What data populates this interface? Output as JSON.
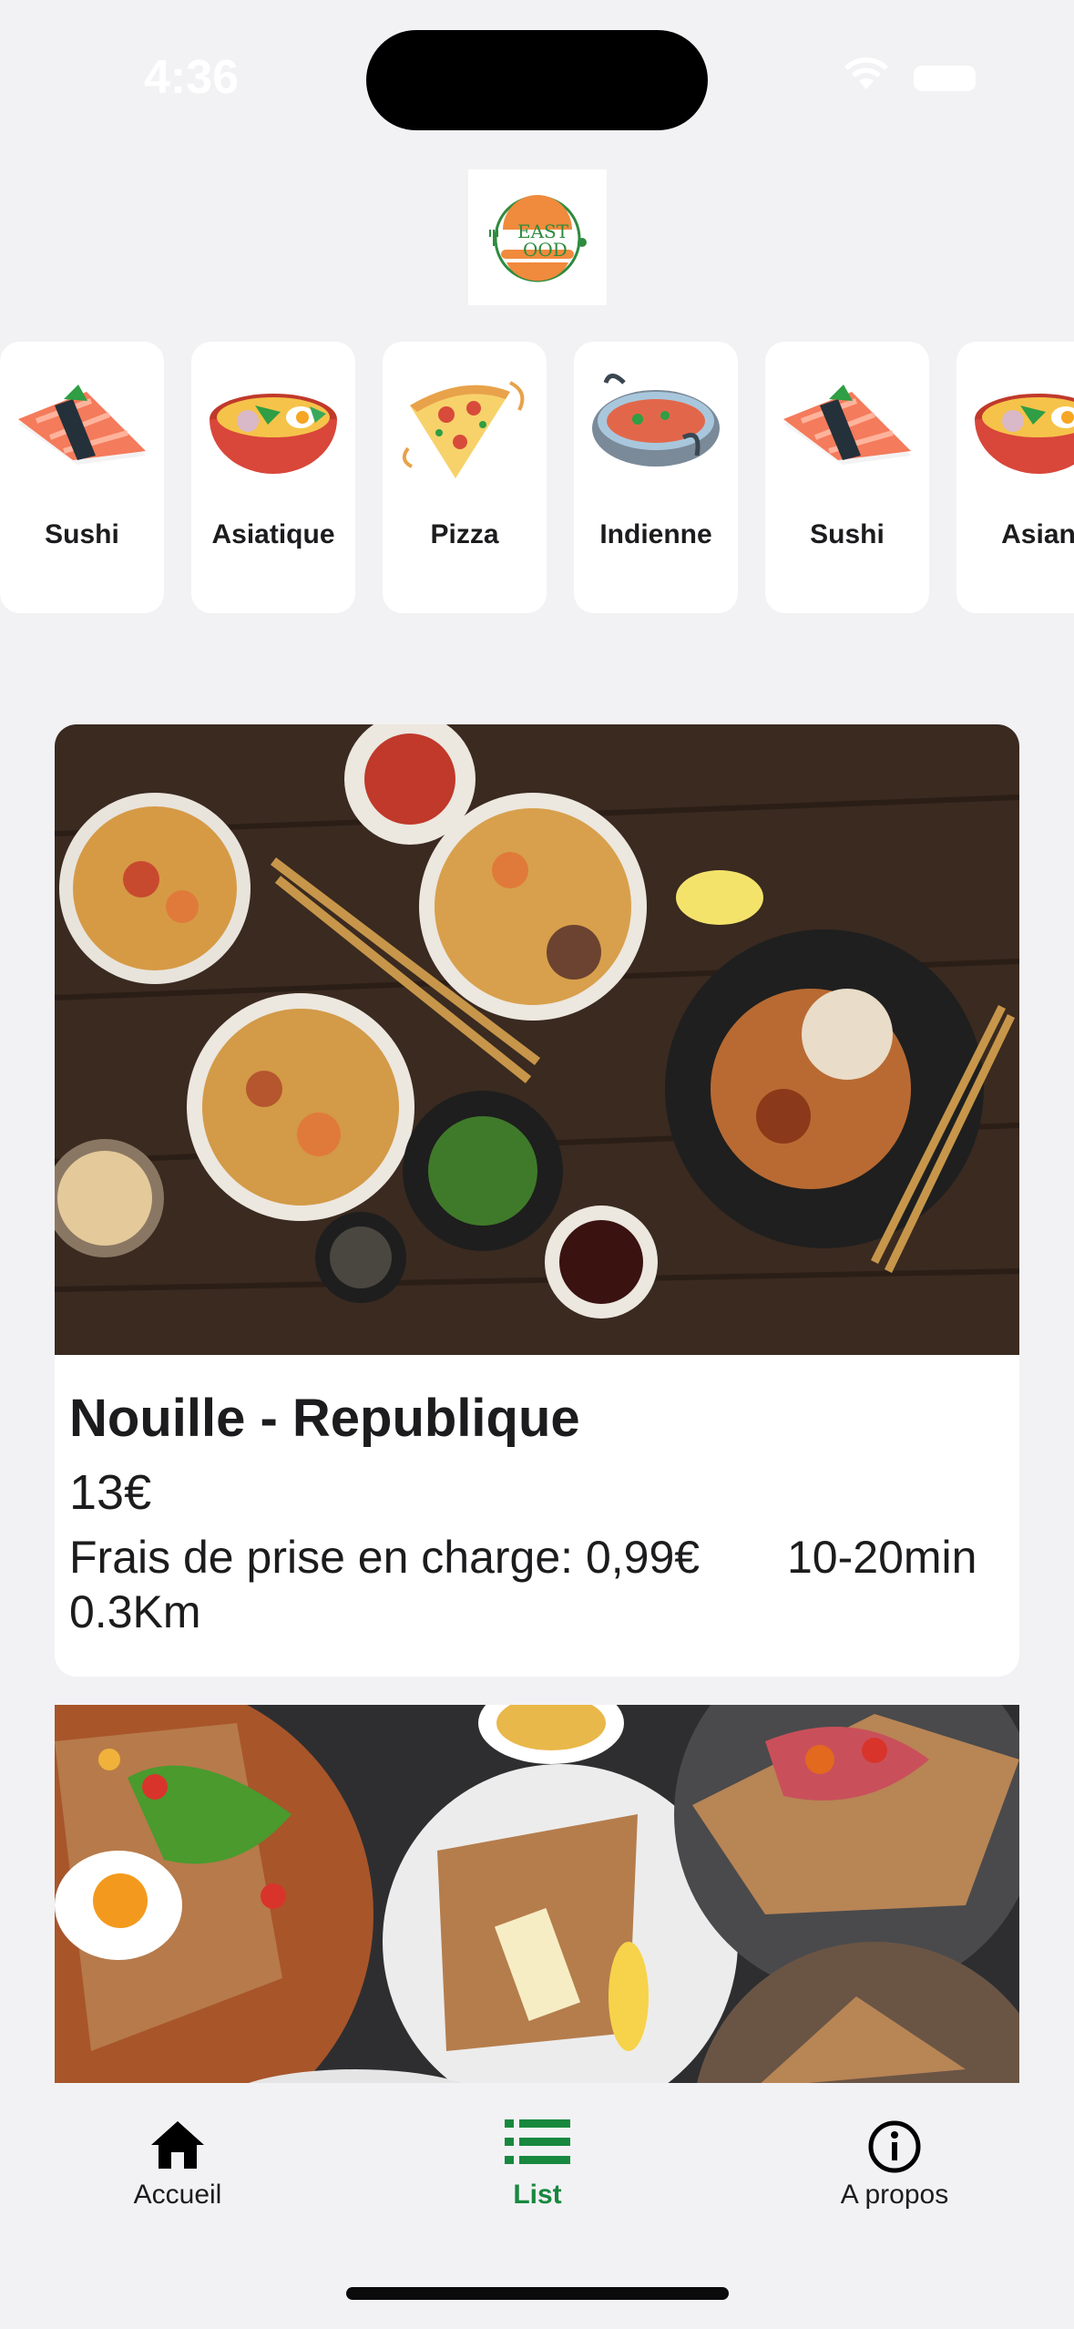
{
  "status_bar": {
    "time": "4:36"
  },
  "logo": {
    "line1": "EAST",
    "line2": "OOD",
    "icon": "fast-food-logo"
  },
  "categories": [
    {
      "label": "Sushi",
      "icon": "sushi-icon"
    },
    {
      "label": "Asiatique",
      "icon": "ramen-bowl-icon"
    },
    {
      "label": "Pizza",
      "icon": "pizza-icon"
    },
    {
      "label": "Indienne",
      "icon": "curry-pot-icon"
    },
    {
      "label": "Sushi",
      "icon": "sushi-icon"
    },
    {
      "label": "Asian",
      "icon": "ramen-bowl-icon"
    }
  ],
  "restaurants": [
    {
      "name": "Nouille - Republique",
      "price": "13€",
      "fee": "Frais de prise en charge: 0,99€",
      "time": "10-20min",
      "distance": "0.3Km",
      "image": "noodles-photo"
    },
    {
      "image": "crepes-photo"
    }
  ],
  "tab_bar": {
    "items": [
      {
        "label": "Accueil",
        "icon": "home-icon"
      },
      {
        "label": "List",
        "icon": "list-icon",
        "active": true
      },
      {
        "label": "A propos",
        "icon": "info-icon"
      }
    ]
  },
  "colors": {
    "accent": "#18883e",
    "background": "#f2f2f4",
    "card": "#ffffff",
    "logo_orange": "#f08a3c"
  }
}
